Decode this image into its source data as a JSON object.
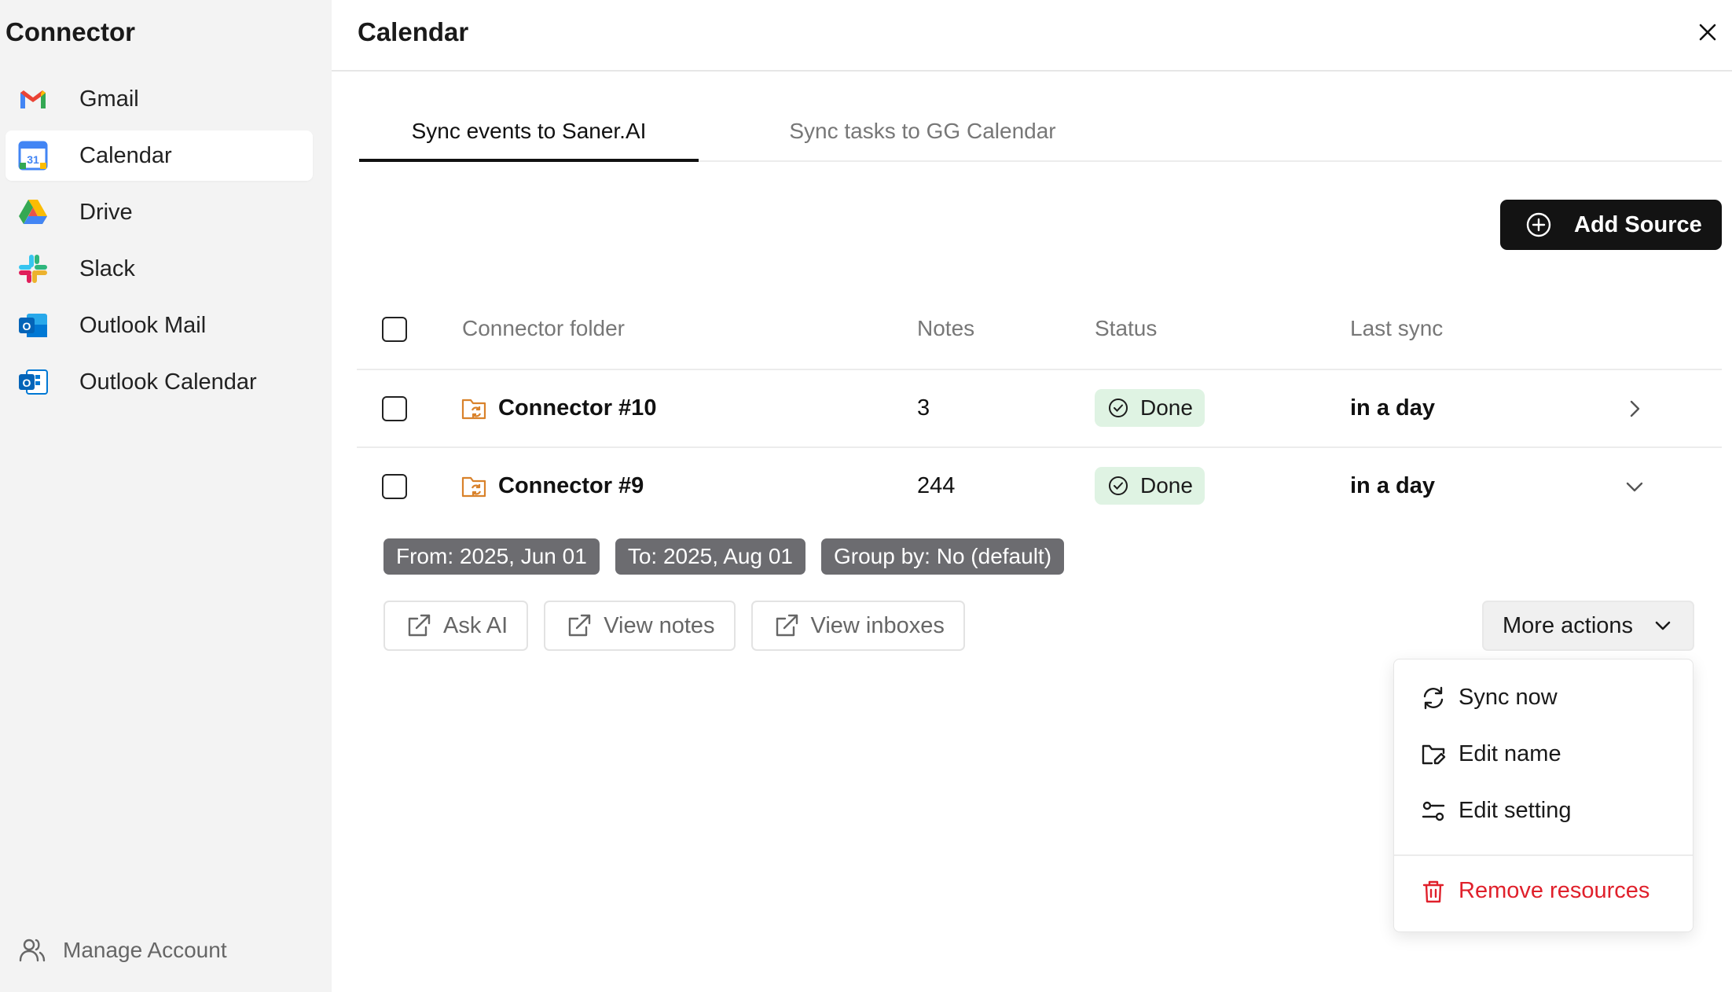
{
  "sidebar": {
    "title": "Connector",
    "items": [
      {
        "label": "Gmail",
        "icon": "gmail-icon"
      },
      {
        "label": "Calendar",
        "icon": "google-calendar-icon",
        "active": true
      },
      {
        "label": "Drive",
        "icon": "google-drive-icon"
      },
      {
        "label": "Slack",
        "icon": "slack-icon"
      },
      {
        "label": "Outlook Mail",
        "icon": "outlook-mail-icon"
      },
      {
        "label": "Outlook Calendar",
        "icon": "outlook-calendar-icon"
      }
    ],
    "manage_account": "Manage Account"
  },
  "header": {
    "title": "Calendar",
    "close_icon": "close-icon"
  },
  "tabs": [
    {
      "label": "Sync events to Saner.AI",
      "active": true
    },
    {
      "label": "Sync tasks to GG Calendar",
      "active": false
    }
  ],
  "add_source": {
    "label": "Add Source",
    "icon": "plus-circle-icon"
  },
  "table": {
    "columns": [
      "Connector folder",
      "Notes",
      "Status",
      "Last sync"
    ],
    "rows": [
      {
        "name": "Connector #10",
        "notes": "3",
        "status": "Done",
        "last_sync": "in a day",
        "expanded": false
      },
      {
        "name": "Connector #9",
        "notes": "244",
        "status": "Done",
        "last_sync": "in a day",
        "expanded": true
      }
    ]
  },
  "expanded": {
    "chips": [
      "From: 2025, Jun 01",
      "To: 2025, Aug 01",
      "Group by: No (default)"
    ],
    "actions": [
      "Ask AI",
      "View notes",
      "View inboxes"
    ],
    "more_actions": "More actions"
  },
  "menu": {
    "items": [
      {
        "label": "Sync now",
        "icon": "refresh-icon"
      },
      {
        "label": "Edit name",
        "icon": "folder-edit-icon"
      },
      {
        "label": "Edit setting",
        "icon": "settings-sliders-icon"
      }
    ],
    "danger": {
      "label": "Remove resources",
      "icon": "trash-icon"
    }
  },
  "colors": {
    "sidebar_bg": "#f3f3f3",
    "primary_button": "#131313",
    "status_done_bg": "#dff3e3",
    "chip_bg": "#6c6c70",
    "danger": "#e0202b",
    "folder_orange": "#d9822b"
  }
}
